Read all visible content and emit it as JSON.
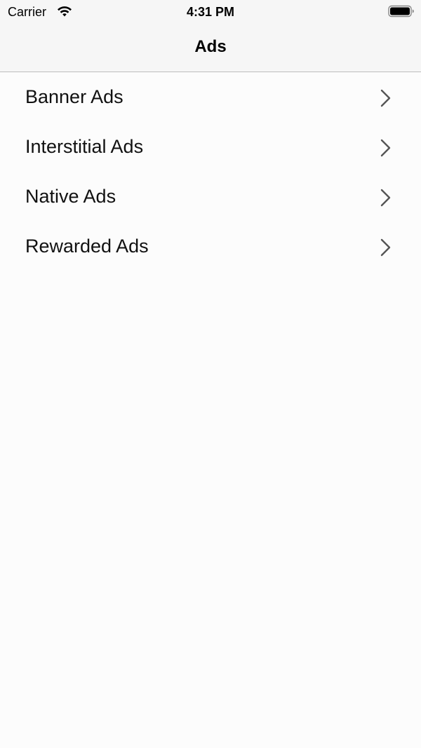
{
  "status_bar": {
    "carrier": "Carrier",
    "time": "4:31 PM",
    "wifi_icon": "wifi-icon",
    "battery_icon": "battery-icon"
  },
  "nav": {
    "title": "Ads"
  },
  "list": {
    "items": [
      {
        "label": "Banner Ads",
        "icon": "chevron-right-icon"
      },
      {
        "label": "Interstitial Ads",
        "icon": "chevron-right-icon"
      },
      {
        "label": "Native Ads",
        "icon": "chevron-right-icon"
      },
      {
        "label": "Rewarded Ads",
        "icon": "chevron-right-icon"
      }
    ]
  },
  "colors": {
    "background": "#fcfcfc",
    "bar_background": "#f6f6f6",
    "separator": "#bdbdbd",
    "chevron": "#555555"
  }
}
